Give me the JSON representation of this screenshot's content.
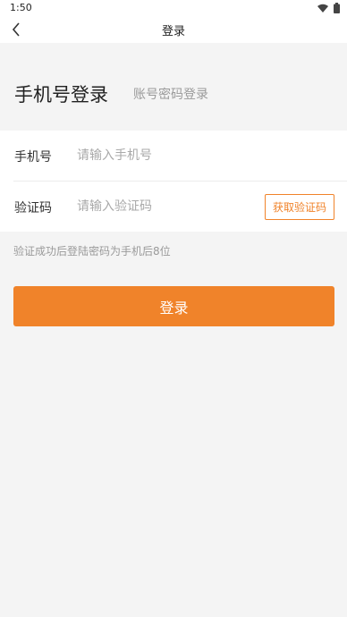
{
  "status_bar": {
    "time": "1:50"
  },
  "nav": {
    "title": "登录"
  },
  "tabs": {
    "phone_login": "手机号登录",
    "account_login": "账号密码登录"
  },
  "form": {
    "phone": {
      "label": "手机号",
      "placeholder": "请输入手机号"
    },
    "code": {
      "label": "验证码",
      "placeholder": "请输入验证码",
      "button": "获取验证码"
    }
  },
  "hint": "验证成功后登陆密码为手机后8位",
  "login_button": "登录",
  "colors": {
    "accent": "#f0832a",
    "background": "#f4f4f4"
  },
  "icons": {
    "back": "chevron-left-icon",
    "wifi": "wifi-icon",
    "battery": "battery-icon"
  }
}
